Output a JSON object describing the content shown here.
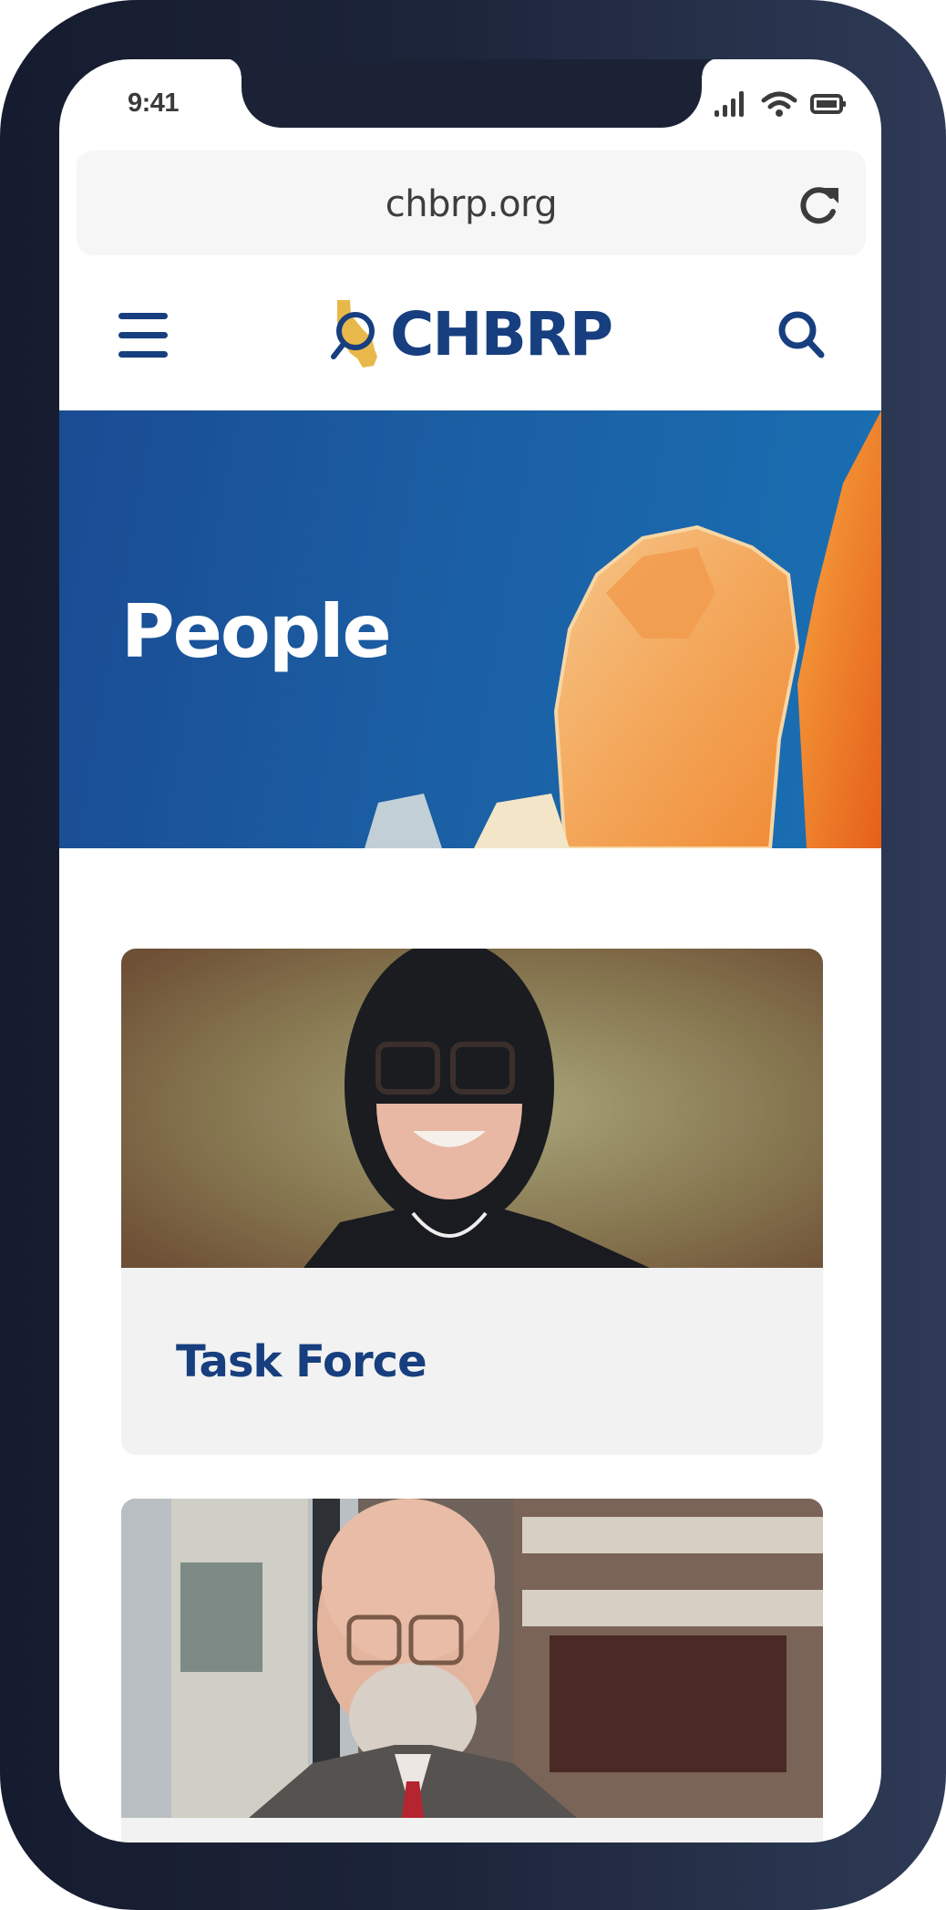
{
  "status_bar": {
    "time": "9:41",
    "icons": [
      "signal-icon",
      "wifi-icon",
      "battery-icon"
    ]
  },
  "browser": {
    "url": "chbrp.org",
    "reload_icon": "reload-icon"
  },
  "header": {
    "menu_icon": "hamburger-menu-icon",
    "logo_text": "CHBRP",
    "search_icon": "search-icon"
  },
  "hero": {
    "title": "People"
  },
  "cards": [
    {
      "title": "Task Force",
      "image": "portrait of woman with glasses"
    },
    {
      "title": "",
      "image": "portrait of man with glasses and beard"
    }
  ],
  "colors": {
    "brand_navy": "#173f7f",
    "brand_gold": "#e8b84a",
    "hero_blue": "#1b5ea3",
    "card_bg": "#f2f2f2",
    "phone_frame": "#1c2439"
  }
}
